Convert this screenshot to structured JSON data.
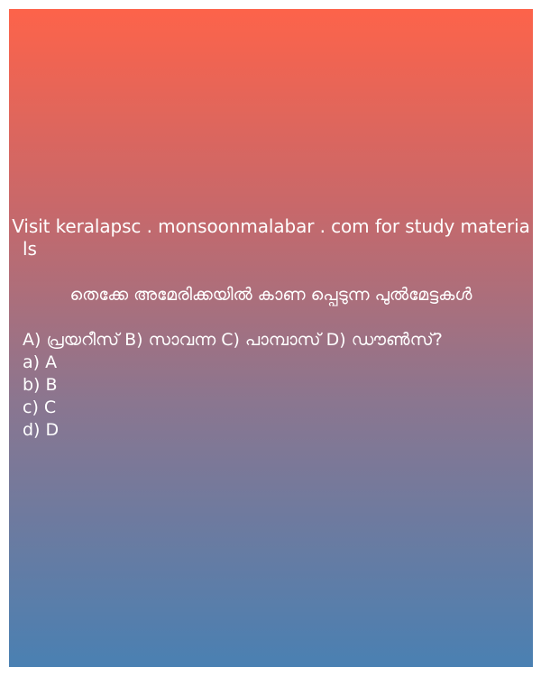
{
  "promo": {
    "line1": "Visit keralapsc . monsoonmalabar . com for study materia",
    "line2": "ls"
  },
  "question": "തെക്കേ അമേരിക്കയിൽ കാണ പ്പെടുന്ന പുൽമേട്ടകൾ",
  "statement": "A) പ്രയറീസ് B) സാവന്ന C) പാമ്പാസ് D) ഡൗൺസ്?",
  "options": [
    "a) A",
    "b) B",
    "c) C",
    "d) D"
  ]
}
